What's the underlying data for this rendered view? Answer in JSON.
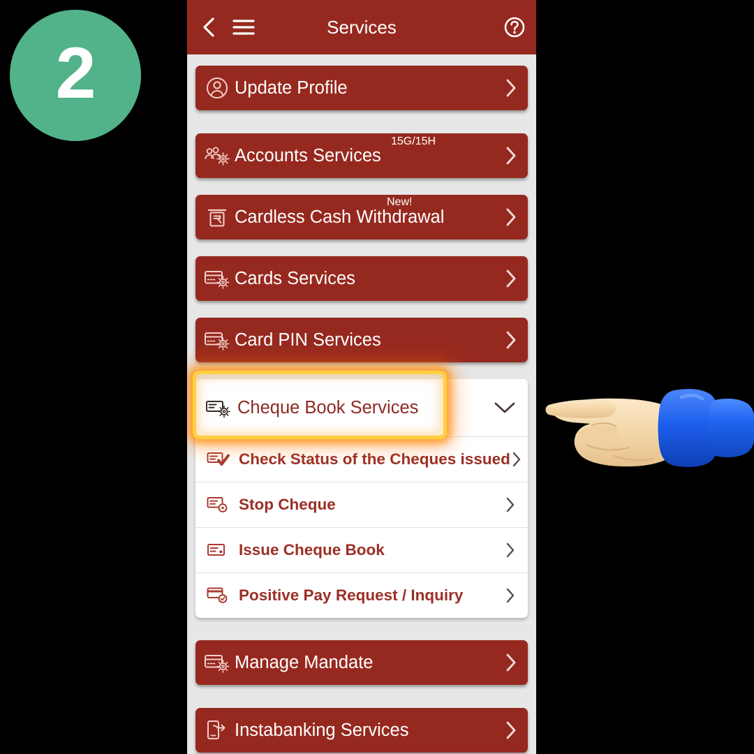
{
  "step_badge": {
    "number": "2",
    "color": "#52b289"
  },
  "theme": {
    "brand_red": "#96291f",
    "page_bg": "#e7e7e7",
    "panel_white": "#ffffff",
    "highlight_ring": "#ffcf3f",
    "sub_item_text": "#9b2f25"
  },
  "header": {
    "title": "Services",
    "back_icon": "chevron-left-icon",
    "menu_icon": "hamburger-menu-icon",
    "help_icon": "help-circle-icon"
  },
  "services": [
    {
      "id": "update-profile",
      "label": "Update Profile",
      "icon": "user-circle-icon",
      "tag": "",
      "chevron": "chevron-right-icon"
    },
    {
      "id": "accounts-services",
      "label": "Accounts Services",
      "icon": "accounts-gear-icon",
      "tag": "15G/15H",
      "chevron": "chevron-right-icon"
    },
    {
      "id": "cardless-cash-withdrawal",
      "label": "Cardless Cash Withdrawal",
      "icon": "atm-rupee-icon",
      "tag": "New!",
      "chevron": "chevron-right-icon"
    },
    {
      "id": "cards-services",
      "label": "Cards Services",
      "icon": "card-gear-icon",
      "tag": "",
      "chevron": "chevron-right-icon"
    },
    {
      "id": "card-pin-services",
      "label": "Card PIN Services",
      "icon": "card-gear-icon",
      "tag": "",
      "chevron": "chevron-right-icon"
    }
  ],
  "expanded_group": {
    "id": "cheque-book-services",
    "label": "Cheque Book Services",
    "icon": "cheque-gear-icon",
    "expanded": true,
    "chevron": "chevron-down-icon",
    "highlighted": true,
    "items": [
      {
        "id": "check-status-of-the-cheques-issued",
        "label": "Check Status of the Cheques issued",
        "icon": "cheque-check-icon",
        "chevron": "chevron-right-icon"
      },
      {
        "id": "stop-cheque",
        "label": "Stop Cheque",
        "icon": "cheque-stop-icon",
        "chevron": "chevron-right-icon"
      },
      {
        "id": "issue-cheque-book",
        "label": "Issue Cheque Book",
        "icon": "cheque-icon",
        "chevron": "chevron-right-icon"
      },
      {
        "id": "positive-pay-request-inquiry",
        "label": "Positive Pay Request / Inquiry",
        "icon": "cheque-approved-icon",
        "chevron": "chevron-right-icon"
      }
    ]
  },
  "services_after": [
    {
      "id": "manage-mandate",
      "label": "Manage Mandate",
      "icon": "card-gear-icon",
      "tag": "",
      "chevron": "chevron-right-icon"
    },
    {
      "id": "instabanking-services",
      "label": "Instabanking Services",
      "icon": "mobile-hand-icon",
      "tag": "",
      "chevron": "chevron-right-icon"
    }
  ],
  "cursor": {
    "type": "pointing-hand-cursor",
    "skin_color": "#f3d8ac",
    "sleeve_color": "#2b6ef0"
  }
}
